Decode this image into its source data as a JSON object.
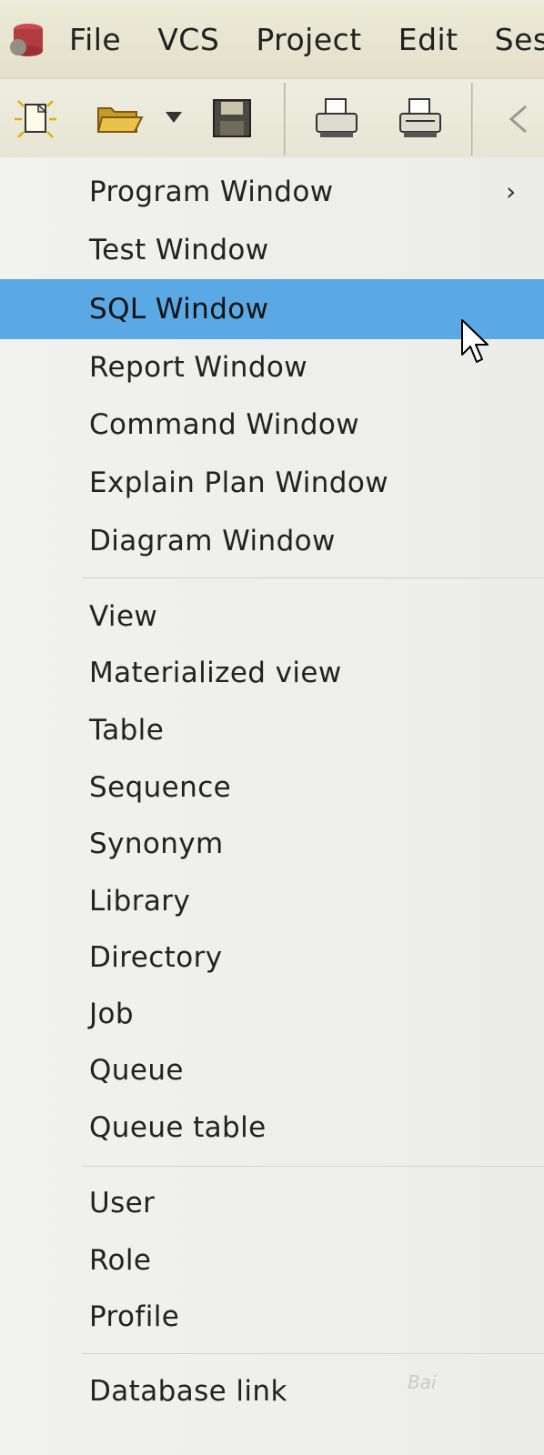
{
  "menubar": {
    "items": [
      "File",
      "VCS",
      "Project",
      "Edit",
      "Ses"
    ]
  },
  "toolbar": {
    "buttons": [
      "new-icon",
      "open-folder-icon",
      "dropdown-arrow-icon",
      "save-icon",
      "print-icon",
      "print-preview-icon",
      "undo-icon"
    ]
  },
  "menu": {
    "items": [
      {
        "label": "Program Window",
        "submenu": true
      },
      {
        "label": "Test Window"
      },
      {
        "label": "SQL Window",
        "selected": true
      },
      {
        "label": "Report Window"
      },
      {
        "label": "Command Window"
      },
      {
        "label": "Explain Plan Window"
      },
      {
        "label": "Diagram Window"
      },
      {
        "label": "View"
      },
      {
        "label": "Materialized view"
      },
      {
        "label": "Table"
      },
      {
        "label": "Sequence"
      },
      {
        "label": "Synonym"
      },
      {
        "label": "Library"
      },
      {
        "label": "Directory"
      },
      {
        "label": "Job"
      },
      {
        "label": "Queue"
      },
      {
        "label": "Queue table"
      },
      {
        "label": "User"
      },
      {
        "label": "Role"
      },
      {
        "label": "Profile"
      },
      {
        "label": "Database link"
      }
    ],
    "submenu_glyph": "›",
    "selected_color": "#5aa8e4"
  },
  "watermark": "Bai"
}
